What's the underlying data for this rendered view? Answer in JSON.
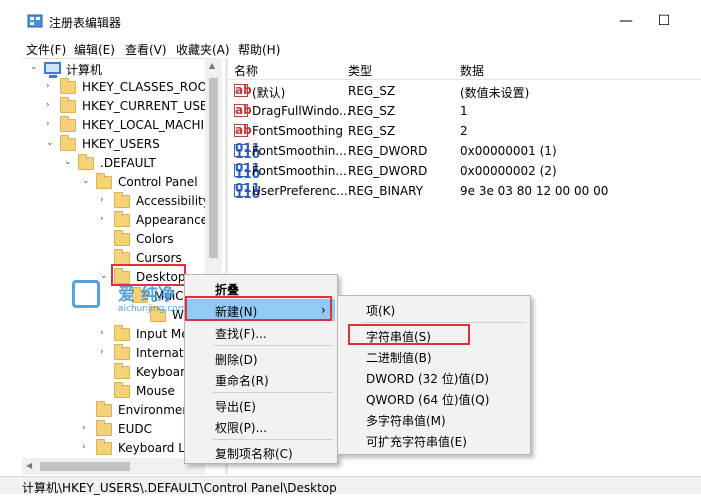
{
  "window": {
    "title": "注册表编辑器",
    "minimize": "—",
    "maximize": "☐"
  },
  "menu": [
    "文件(F)",
    "编辑(E)",
    "查看(V)",
    "收藏夹(A)",
    "帮助(H)"
  ],
  "tree": {
    "root": "计算机",
    "items": [
      {
        "label": "HKEY_CLASSES_ROOT",
        "chev": "›"
      },
      {
        "label": "HKEY_CURRENT_USER",
        "chev": "›"
      },
      {
        "label": "HKEY_LOCAL_MACHINE",
        "chev": "›"
      },
      {
        "label": "HKEY_USERS",
        "chev": "⌄"
      },
      {
        "label": ".DEFAULT",
        "chev": "⌄"
      },
      {
        "label": "Control Panel",
        "chev": "⌄"
      },
      {
        "label": "Accessibility",
        "chev": "›"
      },
      {
        "label": "Appearance",
        "chev": "›"
      },
      {
        "label": "Colors",
        "chev": ""
      },
      {
        "label": "Cursors",
        "chev": ""
      },
      {
        "label": "Desktop",
        "chev": "⌄"
      },
      {
        "label": "MuiC",
        "chev": ""
      },
      {
        "label": "Windo",
        "chev": ""
      },
      {
        "label": "Input Me",
        "chev": "›"
      },
      {
        "label": "Internatio",
        "chev": "›"
      },
      {
        "label": "Keyboard",
        "chev": ""
      },
      {
        "label": "Mouse",
        "chev": ""
      },
      {
        "label": "Environment",
        "chev": ""
      },
      {
        "label": "EUDC",
        "chev": "›"
      },
      {
        "label": "Keyboard La",
        "chev": "›"
      }
    ]
  },
  "list": {
    "headers": {
      "name": "名称",
      "type": "类型",
      "data": "数据"
    },
    "rows": [
      {
        "icon": "ab",
        "name": "(默认)",
        "type": "REG_SZ",
        "data": "(数值未设置)"
      },
      {
        "icon": "ab",
        "name": "DragFullWindo...",
        "type": "REG_SZ",
        "data": "1"
      },
      {
        "icon": "ab",
        "name": "FontSmoothing",
        "type": "REG_SZ",
        "data": "2"
      },
      {
        "icon": "bin",
        "name": "FontSmoothin...",
        "type": "REG_DWORD",
        "data": "0x00000001 (1)"
      },
      {
        "icon": "bin",
        "name": "FontSmoothin...",
        "type": "REG_DWORD",
        "data": "0x00000002 (2)"
      },
      {
        "icon": "bin",
        "name": "UserPreferenc...",
        "type": "REG_BINARY",
        "data": "9e 3e 03 80 12 00 00 00"
      }
    ]
  },
  "context_menu": {
    "items": [
      "折叠",
      "新建(N)",
      "查找(F)...",
      "删除(D)",
      "重命名(R)",
      "导出(E)",
      "权限(P)...",
      "复制项名称(C)"
    ],
    "submenu_arrow": "›"
  },
  "submenu": {
    "items": [
      "项(K)",
      "字符串值(S)",
      "二进制值(B)",
      "DWORD (32 位)值(D)",
      "QWORD (64 位)值(Q)",
      "多字符串值(M)",
      "可扩充字符串值(E)"
    ]
  },
  "status": "计算机\\HKEY_USERS\\.DEFAULT\\Control Panel\\Desktop",
  "watermark": {
    "line1": "爱 纯净",
    "line2": "aichunjing.com"
  }
}
